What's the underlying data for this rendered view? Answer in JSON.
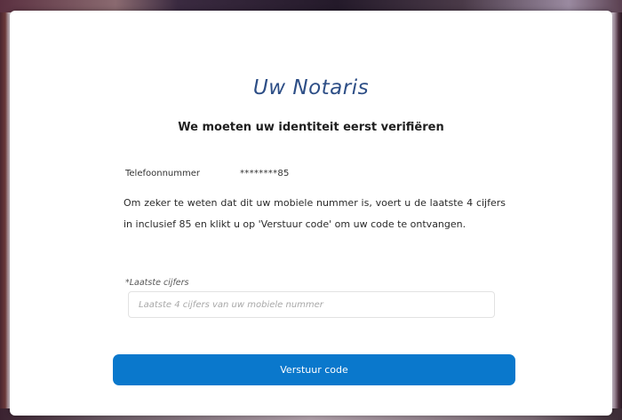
{
  "colors": {
    "accent": "#0a78cc",
    "brand": "#2d4e86",
    "card_background": "#ffffff"
  },
  "brand": {
    "name": "Uw Notaris"
  },
  "verification": {
    "heading": "We moeten uw identiteit eerst verifiëren",
    "phone_label": "Telefoonnummer",
    "phone_value": "********85",
    "instructions": "Om zeker te weten dat dit uw mobiele nummer is, voert u de laatste 4 cijfers in inclusief 85 en klikt u op 'Verstuur code' om uw code te ontvangen.",
    "field_label": "*Laatste cijfers",
    "input_value": "",
    "input_placeholder": "Laatste 4 cijfers van uw mobiele nummer",
    "submit_label": "Verstuur code"
  }
}
